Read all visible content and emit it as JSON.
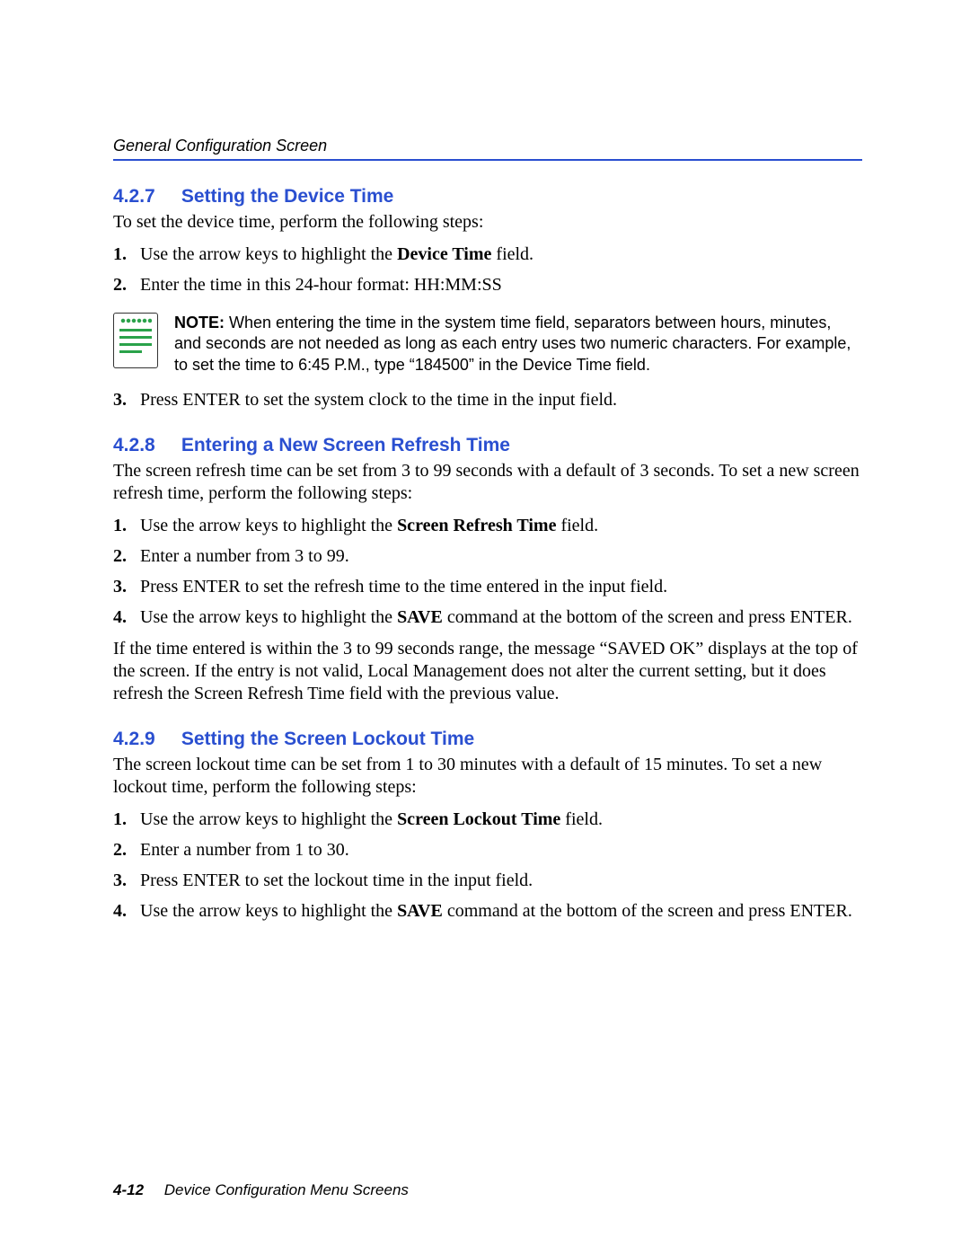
{
  "header": {
    "running_title": "General Configuration Screen"
  },
  "sections": {
    "s427": {
      "num": "4.2.7",
      "title": "Setting the Device Time",
      "intro": "To set the device time, perform the following steps:",
      "step1_pre": "Use the arrow keys to highlight the ",
      "step1_bold": "Device Time",
      "step1_post": " field.",
      "step2": "Enter the time in this 24-hour format: HH:MM:SS",
      "note_label": "NOTE:",
      "note_body": "  When entering the time in the system time field, separators between hours, minutes, and seconds are not needed as long as each entry uses two numeric characters. For example, to set the time to 6:45 P.M., type “184500” in the Device Time field.",
      "step3": "Press ENTER to set the system clock to the time in the input field."
    },
    "s428": {
      "num": "4.2.8",
      "title": "Entering a New Screen Refresh Time",
      "intro": "The screen refresh time can be set from 3 to 99 seconds with a default of 3 seconds. To set a new screen refresh time, perform the following steps:",
      "step1_pre": "Use the arrow keys to highlight the ",
      "step1_bold": "Screen Refresh Time",
      "step1_post": " field.",
      "step2": "Enter a number from 3 to 99.",
      "step3": "Press ENTER to set the refresh time to the time entered in the input field.",
      "step4_pre": "Use the arrow keys to highlight the ",
      "step4_bold": "SAVE",
      "step4_post": " command at the bottom of the screen and press ENTER.",
      "after": "If the time entered is within the 3 to 99 seconds range, the message “SAVED OK” displays at the top of the screen. If the entry is not valid, Local Management does not alter the current setting, but it does refresh the Screen Refresh Time field with the previous value."
    },
    "s429": {
      "num": "4.2.9",
      "title": "Setting the Screen Lockout Time",
      "intro": "The screen lockout time can be set from 1 to 30 minutes with a default of 15 minutes. To set a new lockout time, perform the following steps:",
      "step1_pre": "Use the arrow keys to highlight the ",
      "step1_bold": "Screen Lockout Time",
      "step1_post": " field.",
      "step2": "Enter a number from 1 to 30.",
      "step3": "Press ENTER to set the lockout time in the input field.",
      "step4_pre": "Use the arrow keys to highlight the ",
      "step4_bold": "SAVE",
      "step4_post": " command at the bottom of the screen and press ENTER."
    }
  },
  "footer": {
    "page_num": "4-12",
    "chapter": "Device Configuration Menu Screens"
  }
}
